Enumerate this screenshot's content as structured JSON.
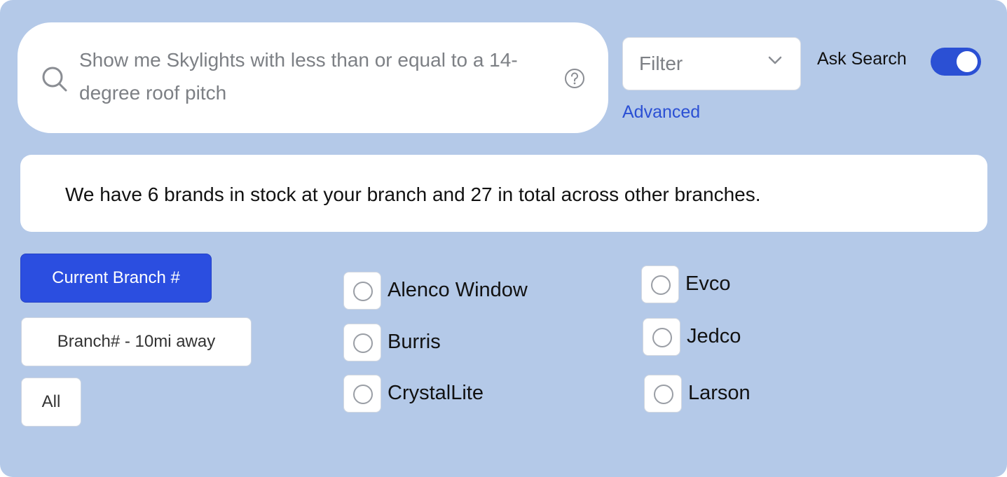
{
  "search": {
    "query": "Show me Skylights with less than or equal to a 14-degree roof pitch",
    "help_icon": "question-circle-icon",
    "search_icon": "magnifier-icon"
  },
  "filter": {
    "selected": "Filter",
    "advanced_link": "Advanced"
  },
  "ask_search": {
    "label": "Ask Search",
    "enabled": true
  },
  "info": {
    "message": "We have 6 brands in stock at your branch and 27 in total across other branches."
  },
  "branch_buttons": {
    "current": "Current Branch #",
    "nearby": "Branch# -  10mi away",
    "all": "All"
  },
  "brands": {
    "col1": [
      "Alenco Window",
      "Burris",
      "CrystalLite"
    ],
    "col2": [
      "Evco",
      "Jedco",
      "Larson"
    ]
  },
  "colors": {
    "accent": "#2b50d4",
    "background": "#b4c9e8"
  }
}
